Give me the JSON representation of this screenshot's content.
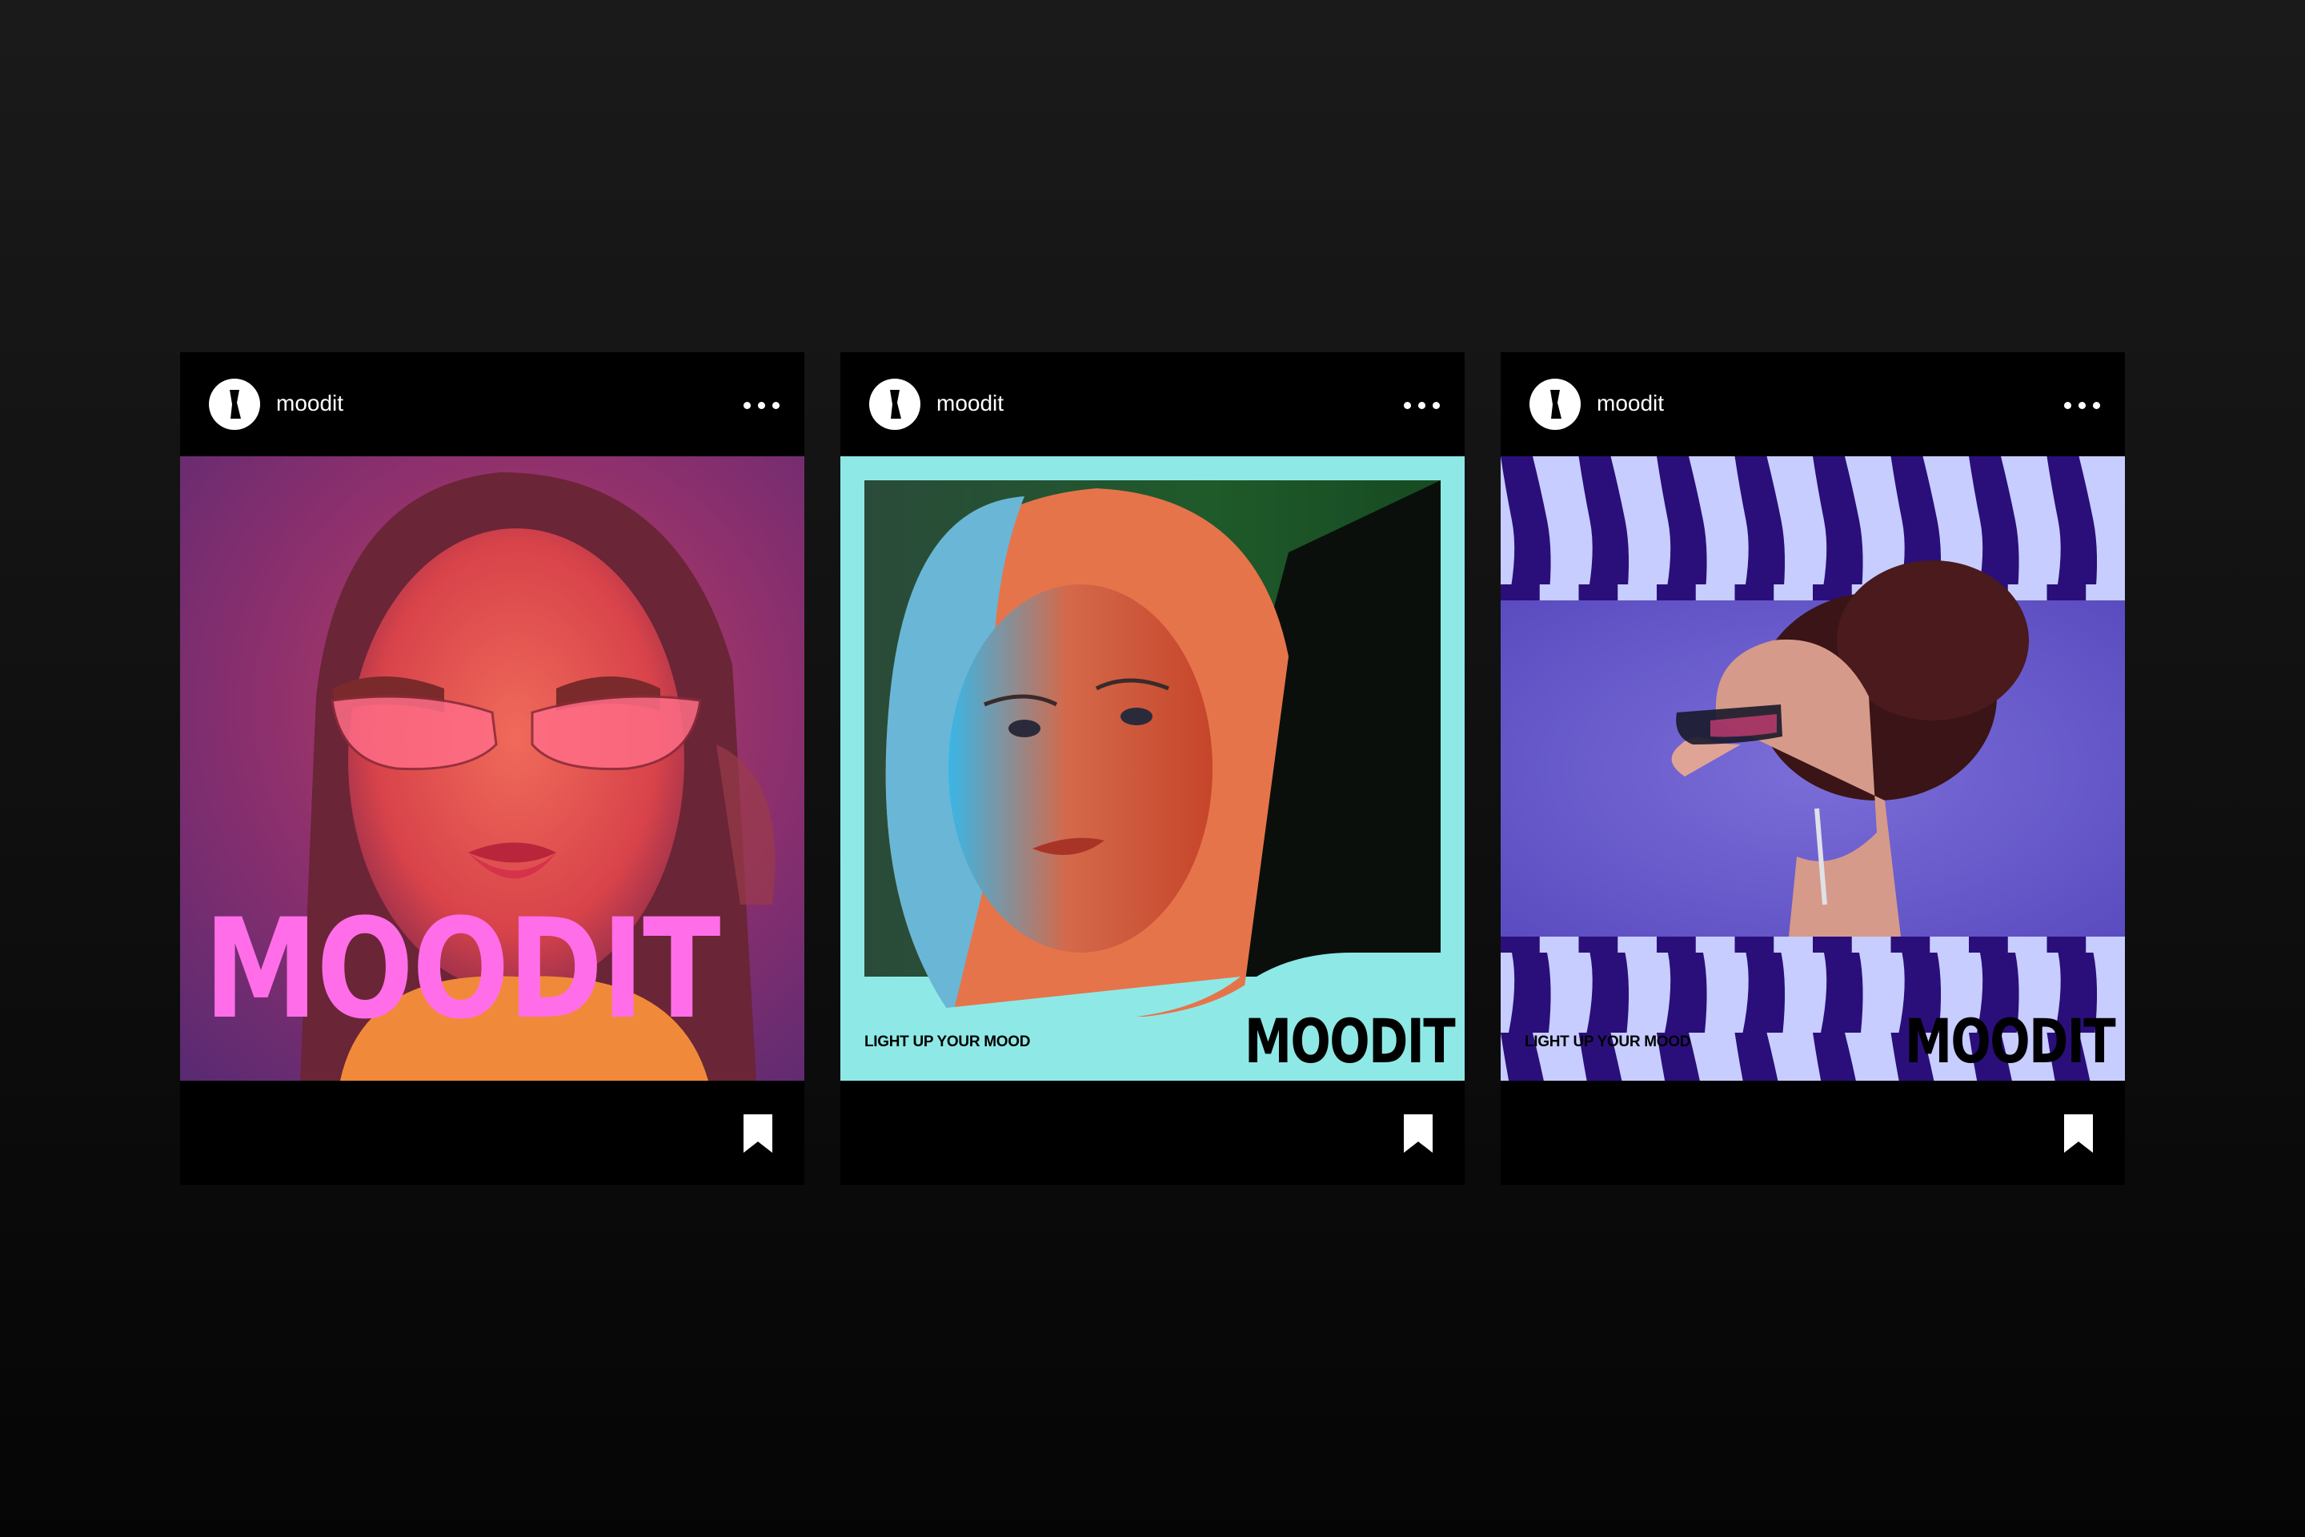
{
  "posts": [
    {
      "username": "moodit",
      "wordmark": "MOODIT",
      "wordmark_color": "#ff6ee8",
      "tagline": "",
      "photo_description_icon": "portrait-photo"
    },
    {
      "username": "moodit",
      "wordmark": "MOODIT",
      "wordmark_color": "#000000",
      "frame_color": "#8ee9e6",
      "tagline": "LIGHT UP YOUR MOOD"
    },
    {
      "username": "moodit",
      "wordmark": "MOODIT",
      "wordmark_color": "#000000",
      "pattern_colors": [
        "#c7cdff",
        "#2a0f7a"
      ],
      "tagline": "LIGHT UP YOUR MOOD"
    }
  ],
  "icons": {
    "avatar": "moodit-logo-icon",
    "menu": "more-options-icon",
    "save": "bookmark-icon"
  },
  "colors": {
    "background": "#111111",
    "card": "#000000",
    "text": "#ffffff"
  }
}
